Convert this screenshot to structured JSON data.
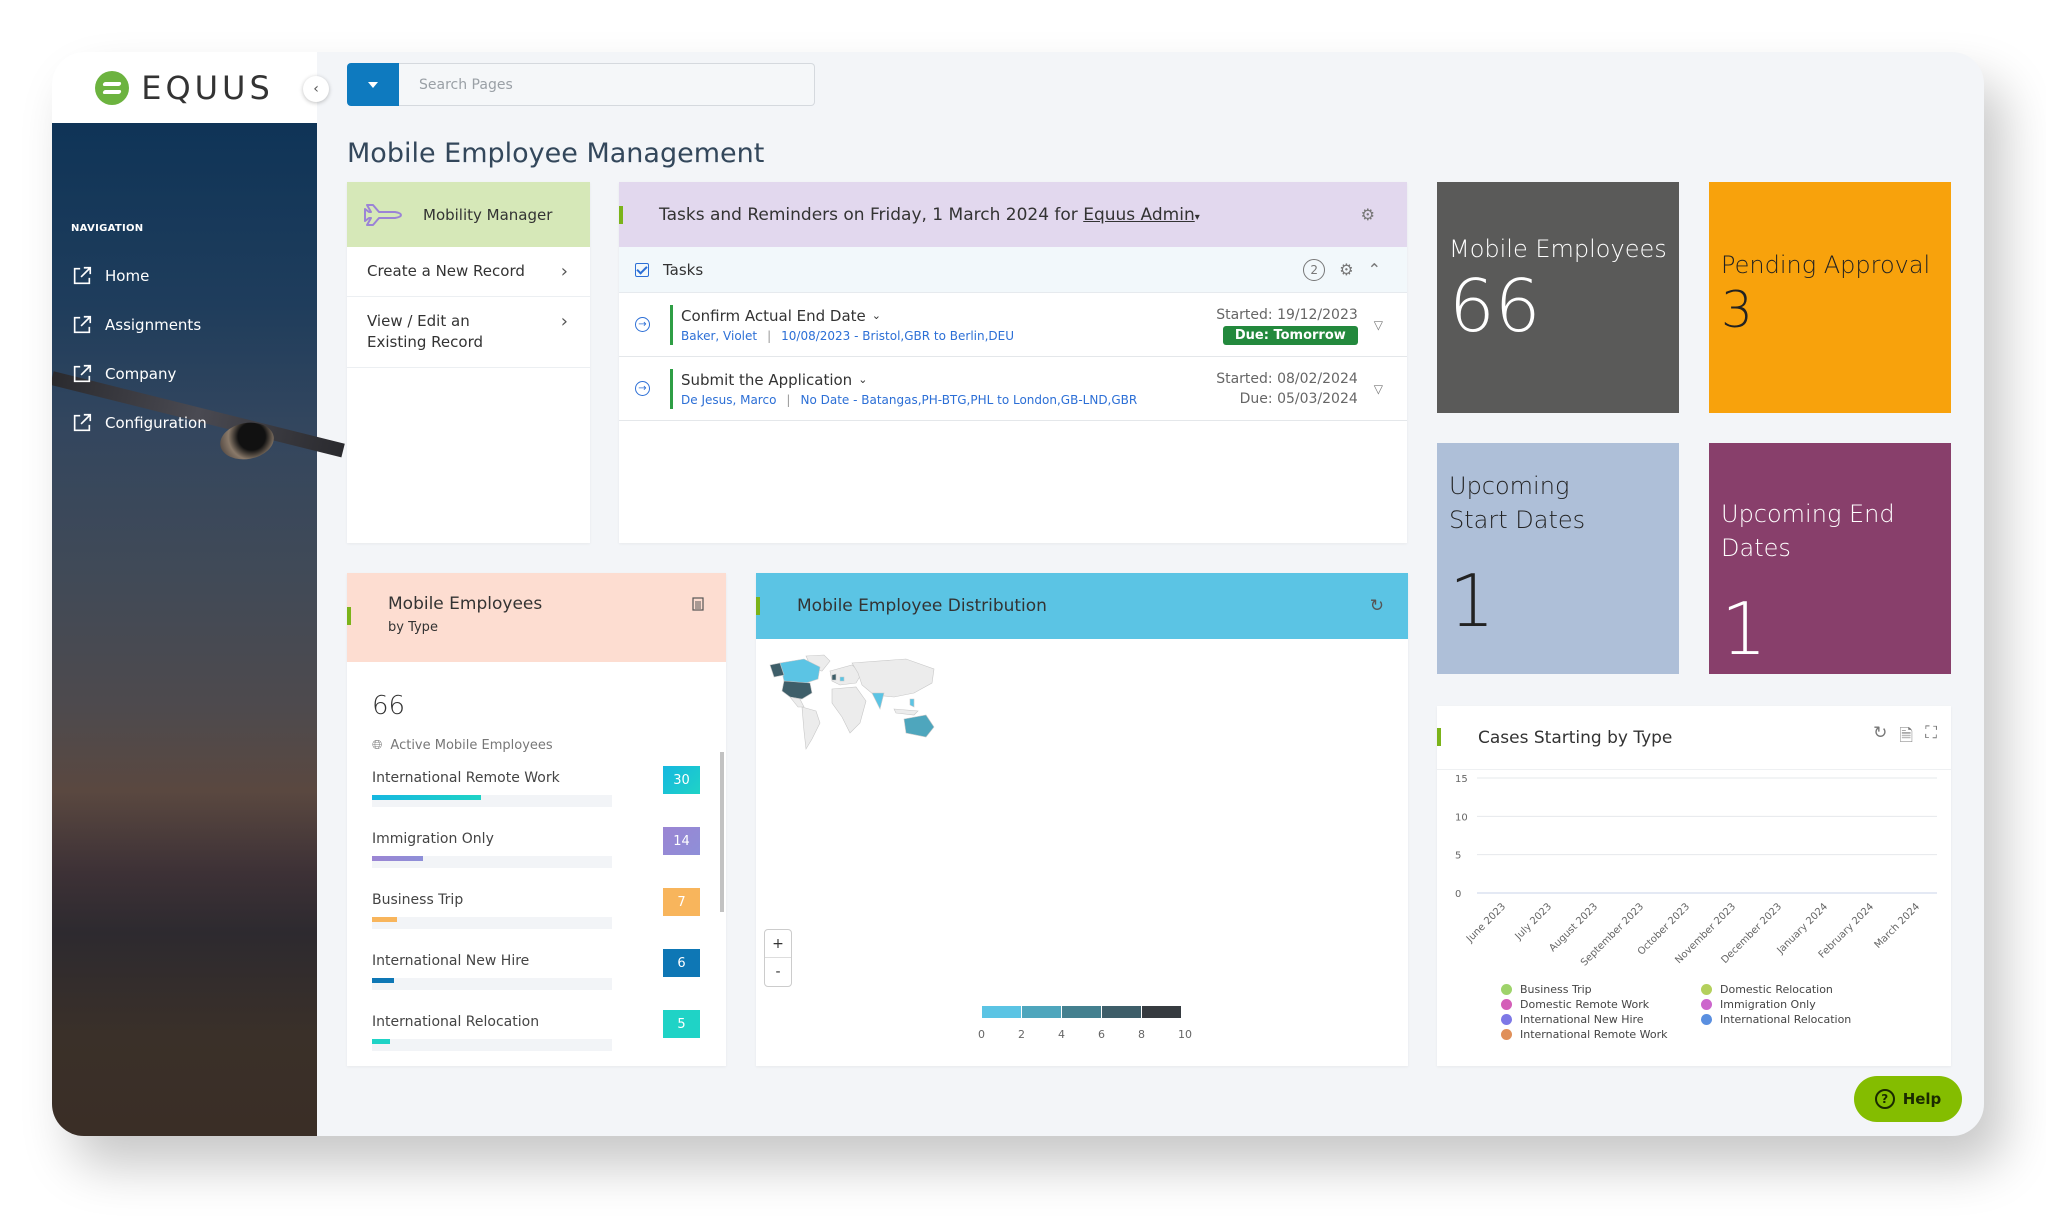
{
  "app": {
    "logo_text": "EQUUS"
  },
  "sidebar": {
    "section_label": "NAVIGATION",
    "items": [
      {
        "label": "Home",
        "icon": "external-link-icon"
      },
      {
        "label": "Assignments",
        "icon": "external-link-icon"
      },
      {
        "label": "Company",
        "icon": "external-link-icon"
      },
      {
        "label": "Configuration",
        "icon": "external-link-icon"
      }
    ]
  },
  "search": {
    "placeholder": "Search Pages",
    "value": ""
  },
  "page": {
    "title": "Mobile Employee Management"
  },
  "mobility_manager": {
    "title": "Mobility Manager",
    "items": [
      {
        "label": "Create a New Record"
      },
      {
        "label": "View / Edit an Existing Record"
      }
    ]
  },
  "tasks_panel": {
    "title_prefix": "Tasks and Reminders on Friday, 1 March 2024 for",
    "user": "Equus Admin",
    "section_label": "Tasks",
    "count": "2",
    "tasks": [
      {
        "title": "Confirm Actual End Date",
        "person": "Baker, Violet",
        "detail": "10/08/2023 - Bristol,GBR to Berlin,DEU",
        "started": "Started: 19/12/2023",
        "due": "Due: Tomorrow",
        "due_highlight": true
      },
      {
        "title": "Submit the Application",
        "person": "De Jesus, Marco",
        "detail": "No Date - Batangas,PH-BTG,PHL to London,GB-LND,GBR",
        "started": "Started: 08/02/2024",
        "due": "Due: 05/03/2024",
        "due_highlight": false
      }
    ]
  },
  "tiles": [
    {
      "label": "Mobile Employees",
      "value": "66",
      "bg": "#5a5a59",
      "fg": "#ffffff"
    },
    {
      "label": "Pending Approval",
      "value": "3",
      "bg": "#f8a20c",
      "fg": "#222222"
    },
    {
      "label": "Upcoming Start Dates",
      "value": "1",
      "bg": "#aebfd8",
      "fg": "#222222"
    },
    {
      "label": "Upcoming End Dates",
      "value": "1",
      "bg": "#883f6b",
      "fg": "#ffffff"
    }
  ],
  "employees_by_type": {
    "title": "Mobile Employees",
    "subtitle": "by Type",
    "total": "66",
    "total_label": "Active Mobile Employees",
    "max": 66,
    "rows": [
      {
        "name": "International Remote Work",
        "value": 30,
        "color": "#1fd3c6",
        "color2": "#16b7e0"
      },
      {
        "name": "Immigration Only",
        "value": 14,
        "color": "#8e8fd8",
        "color2": "#9b85d3"
      },
      {
        "name": "Business Trip",
        "value": 7,
        "color": "#f8b55c",
        "color2": "#f8b55c"
      },
      {
        "name": "International New Hire",
        "value": 6,
        "color": "#0e77b5",
        "color2": "#0e77b5"
      },
      {
        "name": "International Relocation",
        "value": 5,
        "color": "#1fd3c6",
        "color2": "#1fd3c6"
      }
    ]
  },
  "distribution": {
    "title": "Mobile Employee Distribution",
    "zoom_in": "+",
    "zoom_out": "-",
    "scale_colors": [
      "#5bc4e4",
      "#4ea6bd",
      "#44808f",
      "#3e5e69",
      "#363b40"
    ],
    "scale_ticks": [
      "0",
      "2",
      "4",
      "6",
      "8",
      "10"
    ]
  },
  "chart_data": {
    "type": "bar",
    "title": "Cases Starting by Type",
    "xlabel": "",
    "ylabel": "",
    "categories": [
      "June 2023",
      "July 2023",
      "August 2023",
      "September 2023",
      "October 2023",
      "November 2023",
      "December 2023",
      "January 2024",
      "February 2024",
      "March 2024"
    ],
    "yticks": [
      0,
      5,
      10,
      15
    ],
    "ylim": [
      0,
      15
    ],
    "grid": true,
    "legend_position": "bottom",
    "series": [
      {
        "name": "Business Trip",
        "color": "#9ed36a",
        "values": [
          0,
          0,
          0,
          0,
          0,
          0,
          0,
          0,
          0,
          0
        ]
      },
      {
        "name": "Domestic Relocation",
        "color": "#b4d05c",
        "values": [
          0,
          0,
          0,
          0,
          0,
          0,
          0,
          0,
          0,
          0
        ]
      },
      {
        "name": "Domestic Remote Work",
        "color": "#d45fb8",
        "values": [
          0,
          0,
          0,
          0,
          0,
          0,
          0,
          0,
          0,
          0
        ]
      },
      {
        "name": "Immigration Only",
        "color": "#cc66cc",
        "values": [
          0,
          0,
          0,
          0,
          0,
          0,
          0,
          0,
          0,
          0
        ]
      },
      {
        "name": "International New Hire",
        "color": "#7d78e6",
        "values": [
          0,
          0,
          0,
          0,
          0,
          0,
          0,
          0,
          0,
          0
        ]
      },
      {
        "name": "International Relocation",
        "color": "#5a8fe0",
        "values": [
          0,
          0,
          0,
          0,
          0,
          0,
          0,
          0,
          0,
          0
        ]
      },
      {
        "name": "International Remote Work",
        "color": "#e0905a",
        "values": [
          0,
          0,
          0,
          0,
          0,
          0,
          0,
          0,
          0,
          0
        ]
      }
    ]
  },
  "help": {
    "label": "Help"
  }
}
